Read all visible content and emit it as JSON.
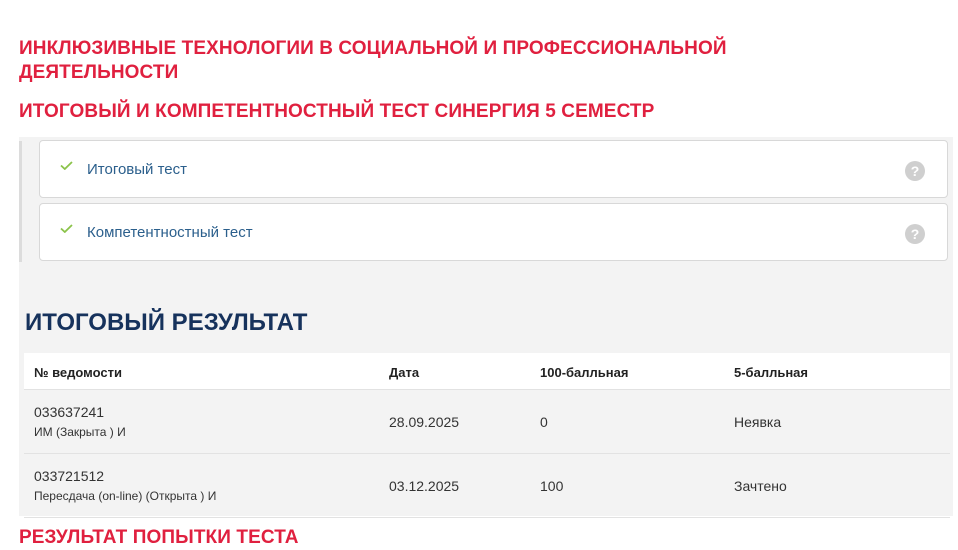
{
  "headings": {
    "course": "ИНКЛЮЗИВНЫЕ  ТЕХНОЛОГИИ  В СОЦИАЛЬНОЙ  И ПРОФЕССИОНАЛЬНОЙ ДЕЯТЕЛЬНОСТИ",
    "test": "ИТОГОВЫЙ И КОМПЕТЕНТНОСТНЫЙ  ТЕСТ СИНЕРГИЯ  5 СЕМЕСТР",
    "cut_off": "РЕЗУЛЬТАТ ПОПЫТКИ ТЕСТА"
  },
  "tests": [
    {
      "label": "Итоговый тест",
      "help": "?"
    },
    {
      "label": "Компетентностный тест",
      "help": "?"
    }
  ],
  "result": {
    "title": "ИТОГОВЫЙ РЕЗУЛЬТАТ",
    "columns": [
      "№ ведомости",
      "Дата",
      "100-балльная",
      "5-балльная"
    ],
    "rows": [
      {
        "number": "033637241",
        "desc": "ИМ (Закрыта ) И",
        "date": "28.09.2025",
        "score100": "0",
        "score5": "Неявка"
      },
      {
        "number": "033721512",
        "desc": "Пересдача (on-line) (Открыта ) И",
        "date": "03.12.2025",
        "score100": "100",
        "score5": "Зачтено"
      }
    ]
  },
  "colors": {
    "heading": "#e0203f",
    "result_title": "#16325c",
    "link": "#2b5f8c",
    "check": "#8bc34a",
    "panel": "#f3f3f3"
  },
  "icons": {
    "status": "check-icon",
    "help": "help-icon"
  }
}
